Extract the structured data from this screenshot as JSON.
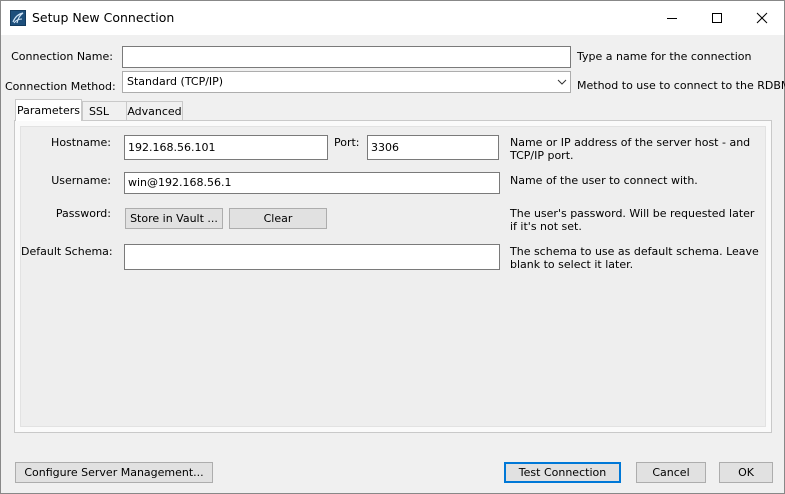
{
  "window": {
    "title": "Setup New Connection",
    "controls": {
      "minimize": "minimize-icon",
      "maximize": "maximize-icon",
      "close": "close-icon"
    }
  },
  "connection_name": {
    "label": "Connection Name:",
    "value": "",
    "hint": "Type a name for the connection"
  },
  "connection_method": {
    "label": "Connection Method:",
    "selected": "Standard (TCP/IP)",
    "hint": "Method to use to connect to the RDBMS"
  },
  "tabs": [
    {
      "label": "Parameters",
      "active": true
    },
    {
      "label": "SSL",
      "active": false
    },
    {
      "label": "Advanced",
      "active": false
    }
  ],
  "parameters": {
    "hostname": {
      "label": "Hostname:",
      "value": "192.168.56.101",
      "hint": "Name or IP address of the server host - and TCP/IP port."
    },
    "port": {
      "label": "Port:",
      "value": "3306"
    },
    "username": {
      "label": "Username:",
      "value": "win@192.168.56.1",
      "hint": "Name of the user to connect with."
    },
    "password": {
      "label": "Password:",
      "store_button": "Store in Vault ...",
      "clear_button": "Clear",
      "hint": "The user's password. Will be requested later if it's not set."
    },
    "default_schema": {
      "label": "Default Schema:",
      "value": "",
      "hint": "The schema to use as default schema. Leave blank to select it later."
    }
  },
  "footer": {
    "configure_button": "Configure Server Management...",
    "test_button": "Test Connection",
    "cancel_button": "Cancel",
    "ok_button": "OK"
  }
}
